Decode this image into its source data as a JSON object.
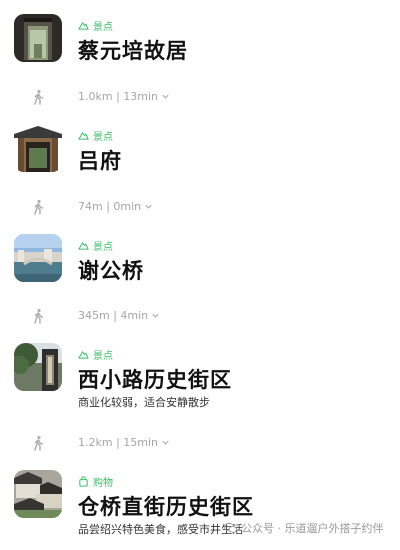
{
  "colors": {
    "tag_green": "#3dbb6a",
    "route_gray": "#a6a6a6"
  },
  "places": [
    {
      "tag": "景点",
      "tag_icon": "mountain-icon",
      "name": "蔡元培故居",
      "desc": ""
    },
    {
      "tag": "景点",
      "tag_icon": "mountain-icon",
      "name": "吕府",
      "desc": ""
    },
    {
      "tag": "景点",
      "tag_icon": "mountain-icon",
      "name": "谢公桥",
      "desc": ""
    },
    {
      "tag": "景点",
      "tag_icon": "mountain-icon",
      "name": "西小路历史街区",
      "desc": "商业化较弱，适合安静散步"
    },
    {
      "tag": "购物",
      "tag_icon": "shopping-bag-icon",
      "name": "仓桥直街历史街区",
      "desc": "品尝绍兴特色美食，感受市井生活"
    }
  ],
  "routes": [
    {
      "text": "1.0km | 13min",
      "icon": "walking-icon"
    },
    {
      "text": "74m | 0min",
      "icon": "walking-icon"
    },
    {
      "text": "345m | 4min",
      "icon": "walking-icon"
    },
    {
      "text": "1.2km | 15min",
      "icon": "walking-icon"
    }
  ],
  "watermark": {
    "text": "公众号 · 乐道遛户外搭子约伴",
    "icon": "wechat-icon"
  }
}
